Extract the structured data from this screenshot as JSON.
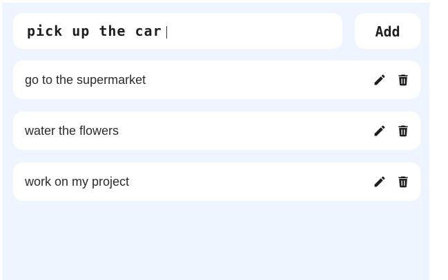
{
  "new_task": {
    "value": "pick up the car",
    "add_label": "Add"
  },
  "todos": [
    {
      "text": "go to the supermarket",
      "edit_icon": "pencil-icon",
      "delete_icon": "trash-icon"
    },
    {
      "text": "water the flowers",
      "edit_icon": "pencil-icon",
      "delete_icon": "trash-icon"
    },
    {
      "text": "work on my project",
      "edit_icon": "pencil-icon",
      "delete_icon": "trash-icon"
    }
  ],
  "colors": {
    "background": "#eef5fe",
    "card": "#ffffff",
    "text": "#2b2b2b",
    "icon": "#1e1e1e"
  }
}
